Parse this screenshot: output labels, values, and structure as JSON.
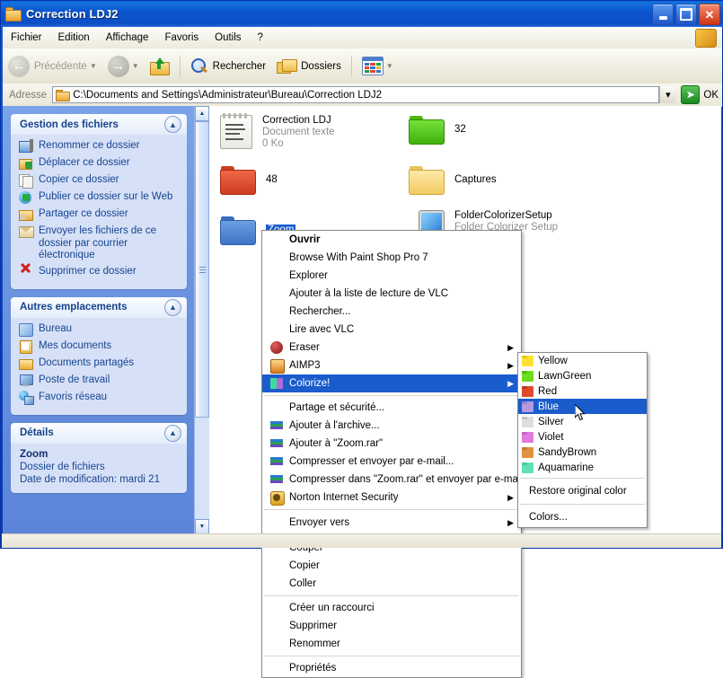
{
  "window": {
    "title": "Correction LDJ2",
    "icon": "folder-icon",
    "buttons": {
      "minimize": "minimize-icon",
      "maximize": "maximize-icon",
      "close": "close-icon"
    }
  },
  "menubar": {
    "items": [
      {
        "label": "Fichier"
      },
      {
        "label": "Edition"
      },
      {
        "label": "Affichage"
      },
      {
        "label": "Favoris"
      },
      {
        "label": "Outils"
      },
      {
        "label": "?"
      }
    ]
  },
  "toolbar": {
    "back_label": "Précédente",
    "forward_label": "",
    "up_label": "",
    "search_label": "Rechercher",
    "folders_label": "Dossiers",
    "views_label": ""
  },
  "address": {
    "label": "Adresse",
    "path": "C:\\Documents and Settings\\Administrateur\\Bureau\\Correction LDJ2",
    "go_label": "OK",
    "dropdown_glyph": "▾"
  },
  "sidebar": {
    "panels": [
      {
        "title": "Gestion des fichiers",
        "items": [
          {
            "label": "Renommer ce dossier",
            "icon": "rename-icon"
          },
          {
            "label": "Déplacer ce dossier",
            "icon": "move-icon"
          },
          {
            "label": "Copier ce dossier",
            "icon": "copy-icon"
          },
          {
            "label": "Publier ce dossier sur le Web",
            "icon": "publish-web-icon"
          },
          {
            "label": "Partager ce dossier",
            "icon": "share-icon"
          },
          {
            "label": "Envoyer les fichiers de ce dossier par courrier électronique",
            "icon": "mail-icon"
          },
          {
            "label": "Supprimer ce dossier",
            "icon": "delete-icon"
          }
        ]
      },
      {
        "title": "Autres emplacements",
        "items": [
          {
            "label": "Bureau",
            "icon": "desktop-icon"
          },
          {
            "label": "Mes documents",
            "icon": "documents-icon"
          },
          {
            "label": "Documents partagés",
            "icon": "shared-documents-icon"
          },
          {
            "label": "Poste de travail",
            "icon": "my-computer-icon"
          },
          {
            "label": "Favoris réseau",
            "icon": "network-icon"
          }
        ]
      }
    ],
    "details": {
      "title": "Détails",
      "name": "Zoom",
      "type": "Dossier de fichiers",
      "modified": "Date de modification: mardi 21"
    }
  },
  "files": [
    {
      "name": "Correction LDJ",
      "subtitle": "Document texte",
      "size": "0 Ko",
      "icon": "text-document-icon"
    },
    {
      "name": "32",
      "subtitle": "",
      "size": "",
      "icon": "folder-icon",
      "color": "#57d117"
    },
    {
      "name": "48",
      "subtitle": "",
      "size": "",
      "icon": "folder-icon",
      "color": "#e8522e"
    },
    {
      "name": "Captures",
      "subtitle": "",
      "size": "",
      "icon": "folder-icon",
      "color": "#f5d47a"
    },
    {
      "name": "Zoom",
      "subtitle": "",
      "size": "",
      "icon": "folder-icon",
      "color": "#4a7fd4",
      "selected": true
    },
    {
      "name": "FolderColorizerSetup",
      "subtitle": "Folder Colorizer Setup",
      "size": "",
      "icon": "setup-application-icon"
    }
  ],
  "context_menu": {
    "items": [
      {
        "label": "Ouvrir",
        "bold": true
      },
      {
        "label": "Browse With Paint Shop Pro 7"
      },
      {
        "label": "Explorer"
      },
      {
        "label": "Ajouter à la liste de lecture de VLC"
      },
      {
        "label": "Rechercher..."
      },
      {
        "label": "Lire avec VLC"
      },
      {
        "label": "Eraser",
        "icon": "eraser-icon",
        "submenu": true
      },
      {
        "label": "AIMP3",
        "icon": "aimp3-icon",
        "submenu": true
      },
      {
        "label": "Colorize!",
        "icon": "colorize-icon",
        "submenu": true,
        "selected": true
      },
      {
        "separator": true
      },
      {
        "label": "Partage et sécurité..."
      },
      {
        "label": "Ajouter à l'archive...",
        "icon": "winrar-icon"
      },
      {
        "label": "Ajouter à \"Zoom.rar\"",
        "icon": "winrar-icon"
      },
      {
        "label": "Compresser et envoyer par e-mail...",
        "icon": "winrar-icon"
      },
      {
        "label": "Compresser dans \"Zoom.rar\" et envoyer par e-mail",
        "icon": "winrar-icon"
      },
      {
        "label": "Norton Internet Security",
        "icon": "norton-icon",
        "submenu": true
      },
      {
        "separator": true
      },
      {
        "label": "Envoyer vers",
        "submenu": true
      },
      {
        "separator": true
      },
      {
        "label": "Couper"
      },
      {
        "label": "Copier"
      },
      {
        "label": "Coller"
      },
      {
        "separator": true
      },
      {
        "label": "Créer un raccourci"
      },
      {
        "label": "Supprimer"
      },
      {
        "label": "Renommer"
      },
      {
        "separator": true
      },
      {
        "label": "Propriétés"
      }
    ]
  },
  "color_menu": {
    "colors": [
      {
        "label": "Yellow",
        "hex": "#ffe033"
      },
      {
        "label": "LawnGreen",
        "hex": "#6ddc1c"
      },
      {
        "label": "Red",
        "hex": "#e04a2c"
      },
      {
        "label": "Blue",
        "hex": "#b49be0",
        "selected": true
      },
      {
        "label": "Silver",
        "hex": "#dedede"
      },
      {
        "label": "Violet",
        "hex": "#e07ae0"
      },
      {
        "label": "SandyBrown",
        "hex": "#e09242"
      },
      {
        "label": "Aquamarine",
        "hex": "#63e0b4"
      }
    ],
    "restore_label": "Restore original color",
    "colors_label": "Colors..."
  },
  "statusbar": {
    "text": ""
  }
}
